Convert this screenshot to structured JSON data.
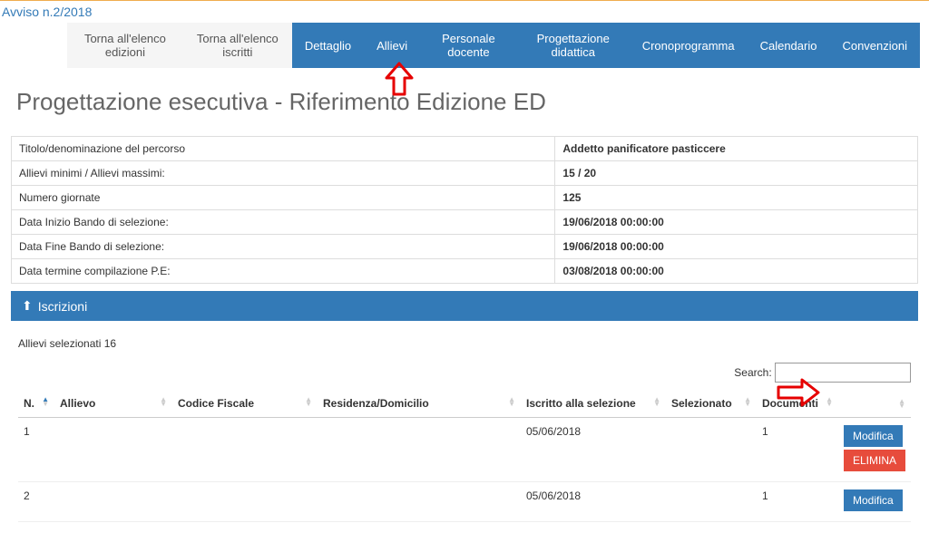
{
  "breadcrumb": "Avviso n.2/2018",
  "tabs": {
    "grey": [
      "Torna all'elenco edizioni",
      "Torna all'elenco iscritti"
    ],
    "blue": [
      "Dettaglio",
      "Allievi",
      "Personale docente",
      "Progettazione didattica",
      "Cronoprogramma",
      "Calendario",
      "Convenzioni"
    ]
  },
  "heading": "Progettazione esecutiva - Riferimento Edizione ED",
  "info": [
    {
      "label": "Titolo/denominazione del percorso",
      "value": "Addetto panificatore pasticcere"
    },
    {
      "label": "Allievi minimi / Allievi massimi:",
      "value": "15 / 20"
    },
    {
      "label": "Numero giornate",
      "value": "125"
    },
    {
      "label": "Data Inizio Bando di selezione:",
      "value": "19/06/2018 00:00:00"
    },
    {
      "label": "Data Fine Bando di selezione:",
      "value": "19/06/2018 00:00:00"
    },
    {
      "label": "Data termine compilazione P.E:",
      "value": "03/08/2018 00:00:00"
    }
  ],
  "section": {
    "title": "Iscrizioni"
  },
  "selected_text": "Allievi selezionati 16",
  "search_label": "Search:",
  "columns": [
    "N.",
    "Allievo",
    "Codice Fiscale",
    "Residenza/Domicilio",
    "Iscritto alla selezione",
    "Selezionato",
    "Documenti",
    ""
  ],
  "rows": [
    {
      "n": "1",
      "allievo": "",
      "cf": "",
      "res": "",
      "iscritto": "05/06/2018",
      "sel": "",
      "doc": "1"
    },
    {
      "n": "2",
      "allievo": "",
      "cf": "",
      "res": "",
      "iscritto": "05/06/2018",
      "sel": "",
      "doc": "1"
    }
  ],
  "actions": {
    "edit": "Modifica",
    "delete": "ELIMINA"
  }
}
